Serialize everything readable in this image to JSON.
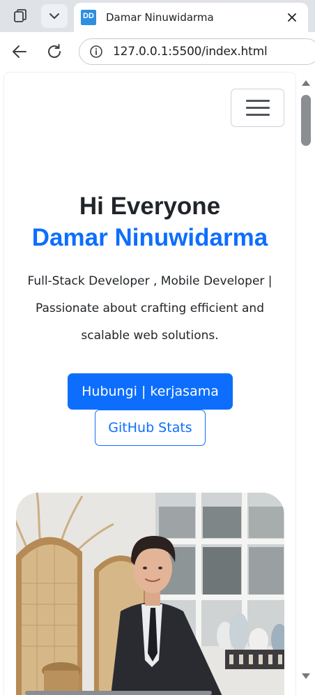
{
  "browser": {
    "tab": {
      "favicon_text": "DD",
      "title": "Damar Ninuwidarma"
    },
    "address_bar": {
      "url": "127.0.0.1:5500/index.html"
    }
  },
  "page": {
    "hero": {
      "greeting": "Hi Everyone",
      "name": "Damar Ninuwidarma",
      "description": "Full-Stack Developer , Mobile Developer | Passionate about crafting efficient and scalable web solutions.",
      "primary_button": "Hubungi | kerjasama",
      "secondary_button": "GitHub Stats"
    }
  },
  "colors": {
    "primary": "#0d6efd",
    "text": "#212529",
    "chrome_bg": "#dfe3e8"
  }
}
